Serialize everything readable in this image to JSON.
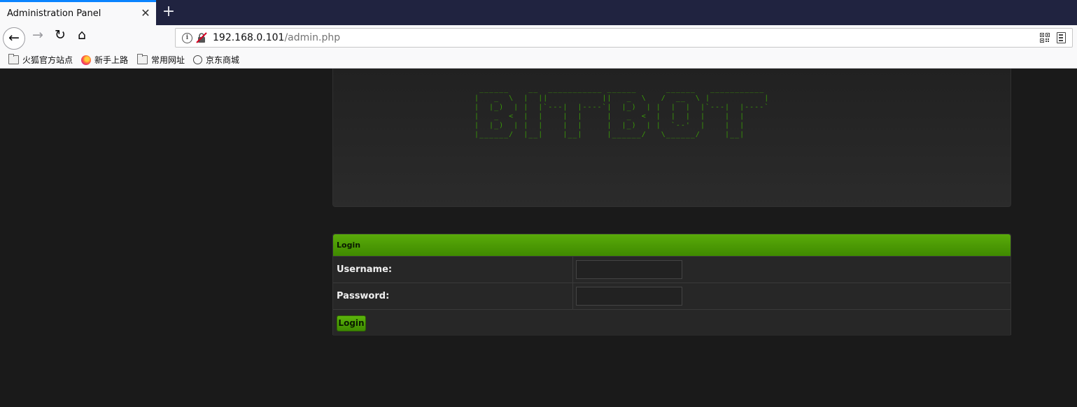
{
  "browser": {
    "tab_title": "Administration Panel",
    "tab_close": "✕",
    "new_tab": "+",
    "url_host": "192.168.0.101",
    "url_path": "/admin.php",
    "nav": {
      "back": "←",
      "forward": "→",
      "reload": "↻",
      "home": "⌂"
    },
    "bookmarks": [
      {
        "label": "火狐官方站点",
        "icon": "folder-icon"
      },
      {
        "label": "新手上路",
        "icon": "firefox-icon"
      },
      {
        "label": "常用网址",
        "icon": "folder-icon"
      },
      {
        "label": "京东商城",
        "icon": "globe-icon"
      }
    ]
  },
  "page": {
    "logo_text": "BITBOT",
    "logo_color": "#3a9a08",
    "login": {
      "title": "Login",
      "username_label": "Username:",
      "username_value": "",
      "password_label": "Password:",
      "password_value": "",
      "submit_label": "Login"
    }
  },
  "colors": {
    "accent": "#4c9a00",
    "background": "#1a1a1a",
    "tab_strip": "#202340"
  }
}
